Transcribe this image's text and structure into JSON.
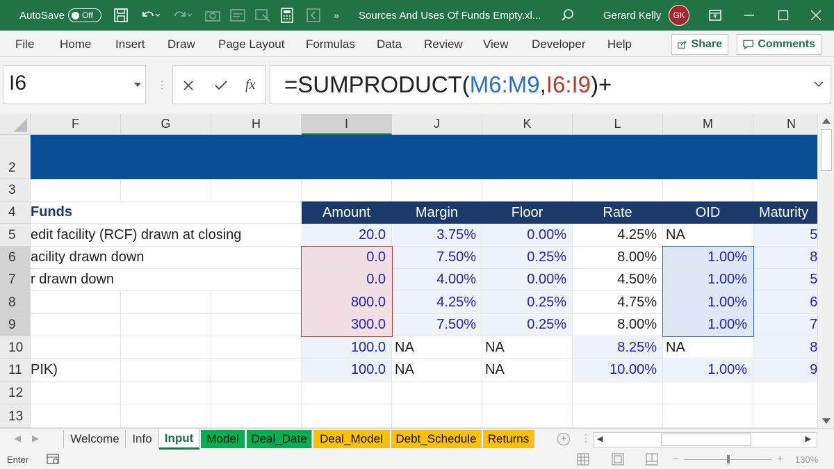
{
  "titlebar": {
    "autosave_label": "AutoSave",
    "autosave_state": "Off",
    "file_name": "Sources And Uses Of Funds Empty.xl...",
    "user_name": "Gerard Kelly",
    "user_initials": "GK",
    "overflow": "»"
  },
  "menu": {
    "tabs": [
      "File",
      "Home",
      "Insert",
      "Draw",
      "Page Layout",
      "Formulas",
      "Data",
      "Review",
      "View",
      "Developer",
      "Help"
    ],
    "share": "Share",
    "comments": "Comments"
  },
  "formula_bar": {
    "name_box": "I6",
    "fx": "fx",
    "formula_prefix": "=SUMPRODUCT(",
    "ref1": "M6:M9",
    "comma": ",",
    "ref2": "I6:I9",
    "formula_suffix": ")+"
  },
  "grid": {
    "columns": [
      "F",
      "G",
      "H",
      "I",
      "J",
      "K",
      "L",
      "M",
      "N"
    ],
    "rows": [
      "2",
      "3",
      "4",
      "5",
      "6",
      "7",
      "8",
      "9",
      "10",
      "11",
      "12",
      "13"
    ],
    "header_row": {
      "label": "Funds",
      "amount": "Amount",
      "margin": "Margin",
      "floor": "Floor",
      "rate": "Rate",
      "oid": "OID",
      "maturity": "Maturity"
    },
    "data_rows": [
      {
        "label": "edit facility (RCF) drawn at closing",
        "amount": "20.0",
        "margin": "3.75%",
        "floor": "0.00%",
        "rate": "4.25%",
        "oid": "NA",
        "maturity": "5.0"
      },
      {
        "label": "acility drawn down",
        "amount": "0.0",
        "margin": "7.50%",
        "floor": "0.25%",
        "rate": "8.00%",
        "oid": "1.00%",
        "maturity": "8.0"
      },
      {
        "label": "r drawn down",
        "amount": "0.0",
        "margin": "4.00%",
        "floor": "0.00%",
        "rate": "4.50%",
        "oid": "1.00%",
        "maturity": "5.0"
      },
      {
        "label": "",
        "amount": "800.0",
        "margin": "4.25%",
        "floor": "0.25%",
        "rate": "4.75%",
        "oid": "1.00%",
        "maturity": "6.0"
      },
      {
        "label": "",
        "amount": "300.0",
        "margin": "7.50%",
        "floor": "0.25%",
        "rate": "8.00%",
        "oid": "1.00%",
        "maturity": "7.0"
      },
      {
        "label": "",
        "amount": "100.0",
        "margin": "NA",
        "floor": "NA",
        "rate": "8.25%",
        "oid": "NA",
        "maturity": "8.0"
      },
      {
        "label": "PIK)",
        "amount": "100.0",
        "margin": "NA",
        "floor": "NA",
        "rate": "10.00%",
        "oid": "1.00%",
        "maturity": "9.0"
      }
    ]
  },
  "sheets": {
    "tabs": [
      {
        "name": "Welcome",
        "color": "#f3f3f3"
      },
      {
        "name": "Info",
        "color": "#f3f3f3"
      },
      {
        "name": "Input",
        "color": "#ffffff",
        "active": true
      },
      {
        "name": "Model",
        "color": "#00b050"
      },
      {
        "name": "Deal_Date",
        "color": "#00b050"
      },
      {
        "name": "Deal_Model",
        "color": "#ffc000"
      },
      {
        "name": "Debt_Schedule",
        "color": "#ffc000"
      },
      {
        "name": "Returns",
        "color": "#ffc000"
      }
    ]
  },
  "status": {
    "mode": "Enter",
    "zoom": "130%"
  },
  "colors": {
    "brand": "#217346",
    "header_fill": "#1b3a6b",
    "banner_fill": "#0a4f96",
    "input_blue": "#1f1fc4",
    "ref1_color": "#2a6fc9",
    "ref2_color": "#c0392b"
  }
}
